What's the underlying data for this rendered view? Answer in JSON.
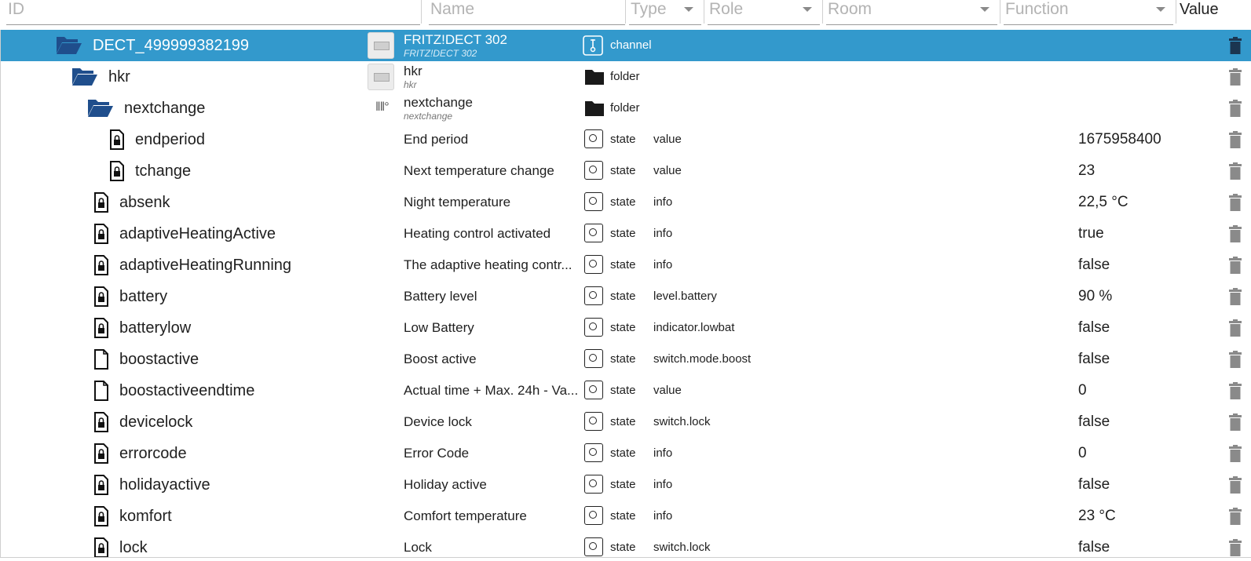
{
  "filters": {
    "id_placeholder": "ID",
    "name_placeholder": "Name",
    "type_label": "Type",
    "role_label": "Role",
    "room_label": "Room",
    "function_label": "Function",
    "value_header": "Value"
  },
  "rows": [
    {
      "id": "DECT_499999382199",
      "name": "FRITZ!DECT 302",
      "name_sub": "FRITZ!DECT 302",
      "type": "channel",
      "role": "",
      "value": ""
    },
    {
      "id": "hkr",
      "name": "hkr",
      "name_sub": "hkr",
      "type": "folder",
      "role": "",
      "value": ""
    },
    {
      "id": "nextchange",
      "name": "nextchange",
      "name_sub": "nextchange",
      "type": "folder",
      "role": "",
      "value": ""
    },
    {
      "id": "endperiod",
      "name": "End period",
      "type": "state",
      "role": "value",
      "value": "1675958400"
    },
    {
      "id": "tchange",
      "name": "Next temperature change",
      "type": "state",
      "role": "value",
      "value": "23"
    },
    {
      "id": "absenk",
      "name": "Night temperature",
      "type": "state",
      "role": "info",
      "value": "22,5 °C"
    },
    {
      "id": "adaptiveHeatingActive",
      "name": "Heating control activated",
      "type": "state",
      "role": "info",
      "value": "true"
    },
    {
      "id": "adaptiveHeatingRunning",
      "name": "The adaptive heating contr...",
      "type": "state",
      "role": "info",
      "value": "false"
    },
    {
      "id": "battery",
      "name": "Battery level",
      "type": "state",
      "role": "level.battery",
      "value": "90 %"
    },
    {
      "id": "batterylow",
      "name": "Low Battery",
      "type": "state",
      "role": "indicator.lowbat",
      "value": "false"
    },
    {
      "id": "boostactive",
      "name": "Boost active",
      "type": "state",
      "role": "switch.mode.boost",
      "value": "false"
    },
    {
      "id": "boostactiveendtime",
      "name": "Actual time + Max. 24h - Va...",
      "type": "state",
      "role": "value",
      "value": "0"
    },
    {
      "id": "devicelock",
      "name": "Device lock",
      "type": "state",
      "role": "switch.lock",
      "value": "false"
    },
    {
      "id": "errorcode",
      "name": "Error Code",
      "type": "state",
      "role": "info",
      "value": "0"
    },
    {
      "id": "holidayactive",
      "name": "Holiday active",
      "type": "state",
      "role": "info",
      "value": "false"
    },
    {
      "id": "komfort",
      "name": "Comfort temperature",
      "type": "state",
      "role": "info",
      "value": "23 °C"
    },
    {
      "id": "lock",
      "name": "Lock",
      "type": "state",
      "role": "switch.lock",
      "value": "false"
    }
  ],
  "icons": {
    "folder_open": "folder-open-icon",
    "file_lock": "file-lock-icon",
    "file": "file-icon",
    "folder": "folder-icon",
    "state": "state-circle-icon",
    "channel": "channel-icon",
    "trash": "trash-icon",
    "device": "thermostat-device-icon",
    "radiator": "radiator-icon"
  },
  "colors": {
    "selected_bg": "#3399cc",
    "folder_blue": "#1f4e8c",
    "trash_grey": "#8a8a8a"
  }
}
